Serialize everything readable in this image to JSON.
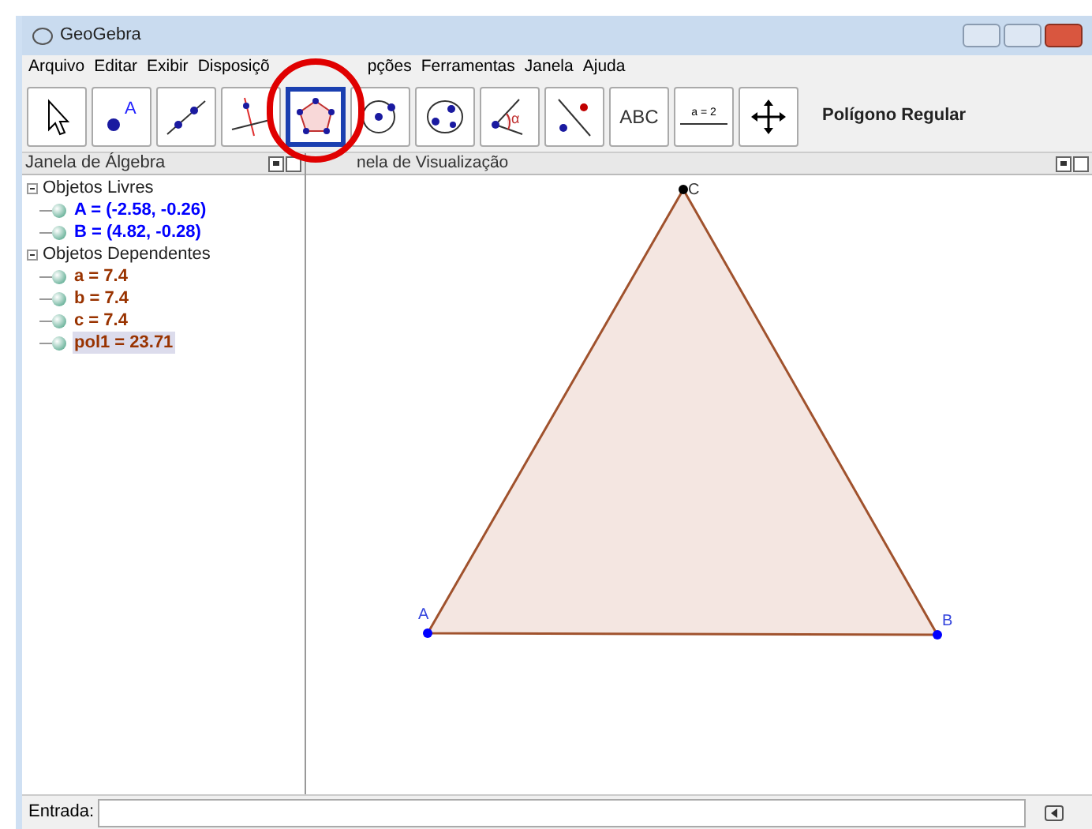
{
  "window": {
    "title": "GeoGebra"
  },
  "menu": [
    "Arquivo",
    "Editar",
    "Exibir",
    "Disposiçõ",
    "pções",
    "Ferramentas",
    "Janela",
    "Ajuda"
  ],
  "toolbar": {
    "tools": [
      {
        "kind": "move",
        "selected": false
      },
      {
        "kind": "point",
        "label": "A",
        "selected": false
      },
      {
        "kind": "line",
        "selected": false
      },
      {
        "kind": "perpendicular",
        "selected": false
      },
      {
        "kind": "polygon",
        "selected": true
      },
      {
        "kind": "circle",
        "selected": false
      },
      {
        "kind": "conic",
        "selected": false
      },
      {
        "kind": "angle",
        "label": "α",
        "selected": false
      },
      {
        "kind": "reflect",
        "selected": false
      },
      {
        "kind": "text",
        "label": "ABC",
        "selected": false
      },
      {
        "kind": "slider",
        "label": "a = 2",
        "selected": false
      },
      {
        "kind": "pan",
        "selected": false
      }
    ],
    "tool_name": "Polígono Regular"
  },
  "algebra": {
    "title": "Janela de Álgebra",
    "groups": [
      {
        "label": "Objetos Livres",
        "expanded": true,
        "children": [
          {
            "text": "A = (-2.58, -0.26)",
            "color": "#0000ff",
            "selected": false
          },
          {
            "text": "B = (4.82, -0.28)",
            "color": "#0000ff",
            "selected": false
          }
        ]
      },
      {
        "label": "Objetos Dependentes",
        "expanded": true,
        "children": [
          {
            "text": "a = 7.4",
            "color": "#993300",
            "selected": false
          },
          {
            "text": "b = 7.4",
            "color": "#993300",
            "selected": false
          },
          {
            "text": "c = 7.4",
            "color": "#993300",
            "selected": false
          },
          {
            "text": "pol1 = 23.71",
            "color": "#993300",
            "selected": true
          }
        ]
      }
    ]
  },
  "graphics": {
    "title": "nela de Visualização",
    "points": [
      {
        "label": "A",
        "color": "#0000ff"
      },
      {
        "label": "B",
        "color": "#0000ff"
      },
      {
        "label": "C",
        "color": "#000000"
      }
    ]
  },
  "input_bar": {
    "label": "Entrada:"
  }
}
